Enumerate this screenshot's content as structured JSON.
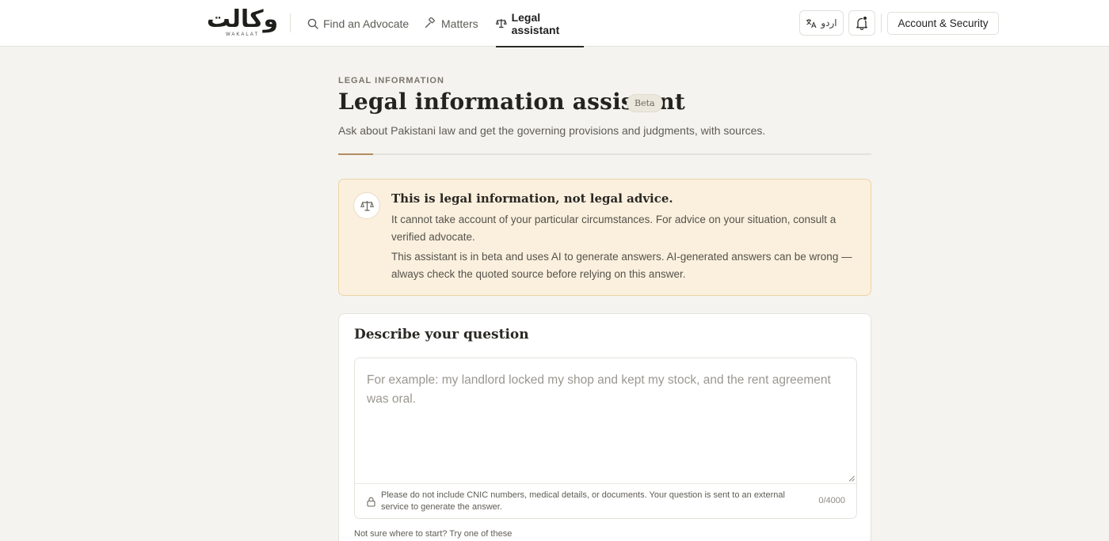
{
  "brand": {
    "logo_text": "وکالت",
    "logo_sub": "WAKALAT"
  },
  "nav": {
    "find_advocate": "Find an Advocate",
    "matters": "Matters",
    "legal_assistant": "Legal assistant"
  },
  "header_actions": {
    "language": "اردو",
    "account": "Account & Security"
  },
  "page": {
    "eyebrow": "LEGAL INFORMATION",
    "title": "Legal information assistant",
    "badge": "Beta",
    "subtitle": "Ask about Pakistani law and get the governing provisions and judgments, with sources."
  },
  "notice": {
    "title": "This is legal information, not legal advice.",
    "p1": "It cannot take account of your particular circumstances. For advice on your situation, consult a verified advocate.",
    "p2": "This assistant is in beta and uses AI to generate answers. AI-generated answers can be wrong — always check the quoted source before relying on this answer."
  },
  "question": {
    "title": "Describe your question",
    "placeholder": "For example: my landlord locked my shop and kept my stock, and the rent agreement was oral.",
    "privacy_note": "Please do not include CNIC numbers, medical details, or documents. Your question is sent to an external service to generate the answer.",
    "char_count": "0/4000",
    "hint": "Not sure where to start? Try one of these"
  }
}
